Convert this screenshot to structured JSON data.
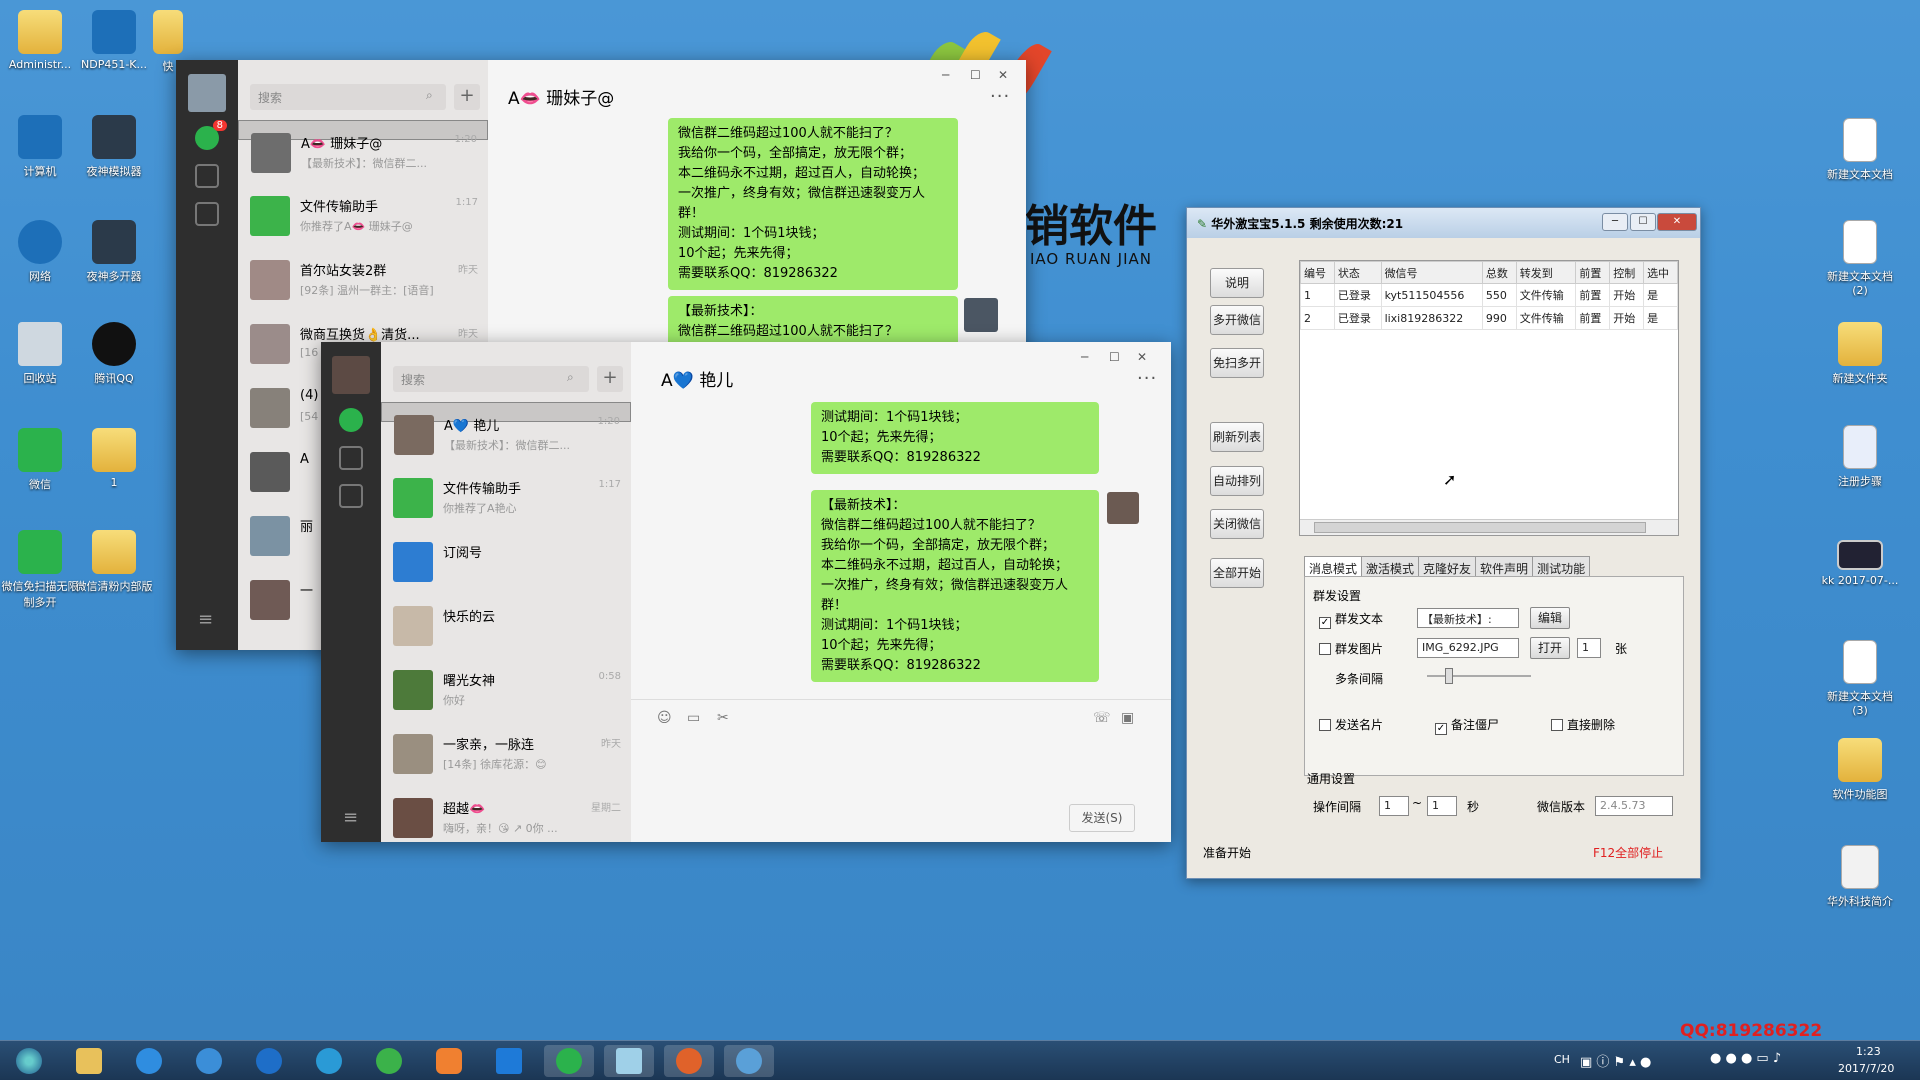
{
  "desktop": {
    "icons_left": [
      {
        "label": "Administr...",
        "type": "folder"
      },
      {
        "label": "NDP451-K...",
        "type": "app"
      },
      {
        "label": "快",
        "type": "folder"
      },
      {
        "label": "计算机",
        "type": "app"
      },
      {
        "label": "夜神模拟器",
        "type": "nox"
      },
      {
        "label": "网络",
        "type": "app"
      },
      {
        "label": "夜神多开器",
        "type": "nox"
      },
      {
        "label": "回收站",
        "type": "app"
      },
      {
        "label": "腾讯QQ",
        "type": "qq"
      },
      {
        "label": "微信",
        "type": "wechat"
      },
      {
        "label": "1",
        "type": "folder"
      },
      {
        "label": "微信免扫描无限制多开",
        "type": "wechat"
      },
      {
        "label": "微信清粉内部版",
        "type": "folder"
      }
    ],
    "icons_right": [
      {
        "label": "新建文本文档",
        "type": "doc"
      },
      {
        "label": "新建文本文档 (2)",
        "type": "doc"
      },
      {
        "label": "新建文件夹",
        "type": "folder"
      },
      {
        "label": "注册步骤",
        "type": "doc"
      },
      {
        "label": "kk 2017-07-...",
        "type": "app"
      },
      {
        "label": "新建文本文档 (3)",
        "type": "doc"
      },
      {
        "label": "软件功能图",
        "type": "folder"
      },
      {
        "label": "华外科技简介",
        "type": "doc"
      }
    ],
    "watermark": "销软件",
    "watermark_sub": "IAO RUAN JIAN",
    "qq_overlay": "QQ:819286322"
  },
  "wechat1": {
    "search_placeholder": "搜索",
    "chat_title": "A👄 珊妹子@",
    "badge": "8",
    "chats": [
      {
        "name": "A👄 珊妹子@",
        "preview": "【最新技术】：微信群二...",
        "time": "1:20"
      },
      {
        "name": "文件传输助手",
        "preview": "你推荐了A👄 珊妹子@",
        "time": "1:17"
      },
      {
        "name": "首尔站女装2群",
        "preview": "[92条] 温州一群主：[语音]",
        "time": "昨天"
      },
      {
        "name": "微商互换货👌清货...",
        "preview": "[16",
        "time": "昨天"
      },
      {
        "name": "(4)",
        "preview": "[54",
        "time": ""
      },
      {
        "name": "A",
        "preview": "",
        "time": ""
      },
      {
        "name": "丽",
        "preview": "",
        "time": ""
      },
      {
        "name": "一",
        "preview": "",
        "time": ""
      }
    ],
    "bubble1": "微信群二维码超过100人就不能扫了？\n我给你一个码，全部搞定，放无限个群；\n本二维码永不过期，超过百人，自动轮换；\n一次推广，终身有效；微信群迅速裂变万人群！\n测试期间：1个码1块钱；\n10个起；先来先得；\n需要联系QQ：819286322",
    "bubble2": "【最新技术】：\n微信群二维码超过100人就不能扫了？"
  },
  "wechat2": {
    "search_placeholder": "搜索",
    "chat_title": "A💙 艳儿",
    "chats": [
      {
        "name": "A💙 艳儿",
        "preview": "【最新技术】：微信群二...",
        "time": "1:20"
      },
      {
        "name": "文件传输助手",
        "preview": "你推荐了A艳心",
        "time": "1:17"
      },
      {
        "name": "订阅号",
        "preview": "",
        "time": ""
      },
      {
        "name": "快乐的云",
        "preview": "",
        "time": ""
      },
      {
        "name": "曙光女神",
        "preview": "你好",
        "time": "0:58"
      },
      {
        "name": "一家亲，一脉连",
        "preview": "[14条] 徐库花源：😊",
        "time": "昨天"
      },
      {
        "name": "超越👄",
        "preview": "嗨呀，亲！😘 ↗ 0你 ...",
        "time": "星期二"
      }
    ],
    "bubble1": "测试期间：1个码1块钱；\n10个起；先来先得；\n需要联系QQ：819286322",
    "bubble2": "【最新技术】：\n微信群二维码超过100人就不能扫了？\n我给你一个码，全部搞定，放无限个群；\n本二维码永不过期，超过百人，自动轮换；\n一次推广，终身有效；微信群迅速裂变万人群！\n测试期间：1个码1块钱；\n10个起；先来先得；\n需要联系QQ：819286322",
    "send_label": "发送(S)"
  },
  "tool": {
    "title": "华外激宝宝5.1.5    剩余使用次数:21",
    "side_buttons": [
      "说明",
      "多开微信",
      "免扫多开",
      "刷新列表",
      "自动排列",
      "关闭微信",
      "全部开始"
    ],
    "columns": [
      "编号",
      "状态",
      "微信号",
      "总数",
      "转发到",
      "前置",
      "控制",
      "选中"
    ],
    "rows": [
      [
        "1",
        "已登录",
        "kyt511504556",
        "550",
        "文件传输",
        "前置",
        "开始",
        "是"
      ],
      [
        "2",
        "已登录",
        "lixi819286322",
        "990",
        "文件传输",
        "前置",
        "开始",
        "是"
      ]
    ],
    "tabs": [
      "消息模式",
      "激活模式",
      "克隆好友",
      "软件声明",
      "测试功能"
    ],
    "group_title": "群发设置",
    "send_text_label": "群发文本",
    "send_text_value": "【最新技术】:",
    "edit_label": "编辑",
    "send_image_label": "群发图片",
    "image_value": "IMG_6292.JPG",
    "open_label": "打开",
    "image_count": "1",
    "image_unit": "张",
    "interval_label": "多条间隔",
    "card_label": "发送名片",
    "zombie_label": "备注僵尸",
    "delete_label": "直接删除",
    "general_title": "通用设置",
    "op_interval_label": "操作间隔",
    "op_min": "1",
    "op_sep": "~",
    "op_max": "1",
    "op_unit": "秒",
    "version_label": "微信版本",
    "version_value": "2.4.5.73",
    "status_left": "准备开始",
    "status_right": "F12全部停止"
  },
  "taskbar": {
    "tray_lang": "CH",
    "time": "1:23",
    "date": "2017/7/20"
  }
}
